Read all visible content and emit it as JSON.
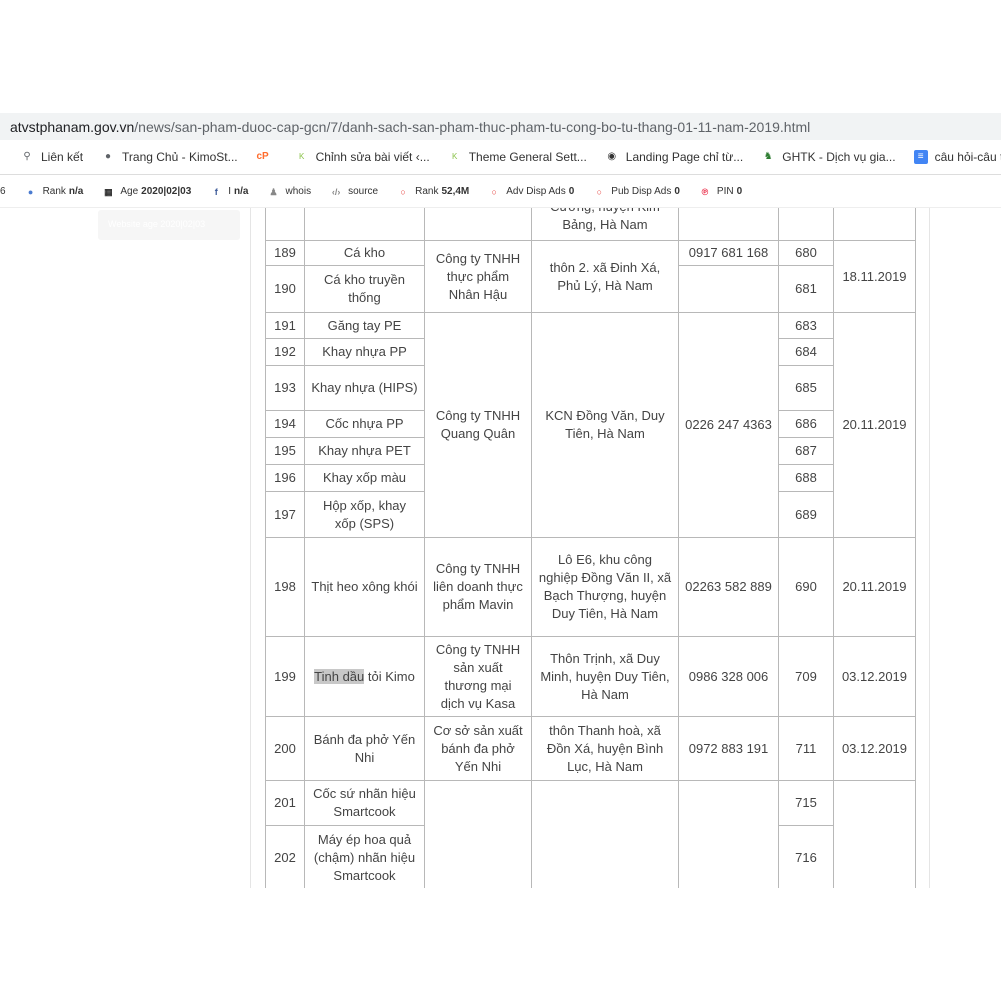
{
  "browser": {
    "url_domain": "atvstphanam.gov.vn",
    "url_path": "/news/san-pham-duoc-cap-gcn/7/danh-sach-san-pham-thuc-pham-tu-cong-bo-tu-thang-01-11-nam-2019.html"
  },
  "bookmarks": [
    {
      "label": "Liên kết",
      "icon": "link-icon",
      "color": "#5f6368"
    },
    {
      "label": "Trang Chủ - KimoSt...",
      "icon": "globe-icon",
      "color": "#5f6368"
    },
    {
      "label": "",
      "icon": "cpanel-icon",
      "color": "#ff6c2c"
    },
    {
      "label": "Chỉnh sửa bài viết ‹...",
      "icon": "kimo-shop-icon",
      "color": "#8bc34a"
    },
    {
      "label": "Theme General Sett...",
      "icon": "kimo-shop-icon",
      "color": "#8bc34a"
    },
    {
      "label": "Landing Page chỉ từ...",
      "icon": "landing-icon",
      "color": "#333333"
    },
    {
      "label": "GHTK - Dịch vụ gia...",
      "icon": "ghtk-icon",
      "color": "#2e7d32"
    },
    {
      "label": "câu hỏi-câu tra",
      "icon": "docs-icon",
      "color": "#4285f4"
    }
  ],
  "extension": [
    {
      "label": "6",
      "value": "",
      "icon": ""
    },
    {
      "label": "Rank",
      "value": "n/a",
      "icon": "alexa-icon"
    },
    {
      "label": "Age",
      "value": "2020|02|03",
      "icon": "calendar-icon"
    },
    {
      "label": "I",
      "value": "n/a",
      "icon": "facebook-icon"
    },
    {
      "label": "whois",
      "value": "",
      "icon": "user-icon"
    },
    {
      "label": "source",
      "value": "",
      "icon": "code-icon"
    },
    {
      "label": "Rank",
      "value": "52,4M",
      "icon": "opera-icon"
    },
    {
      "label": "Adv Disp Ads",
      "value": "0",
      "icon": "opera-icon"
    },
    {
      "label": "Pub Disp Ads",
      "value": "0",
      "icon": "opera-icon"
    },
    {
      "label": "PIN",
      "value": "0",
      "icon": "pinterest-icon"
    }
  ],
  "sidebox": "Website age 2020|02|03",
  "table": {
    "partial_address": "Cương, huyện Kim Bảng, Hà Nam",
    "g1": {
      "company": "Công ty TNHH thực phẩm Nhân Hậu",
      "address": "thôn 2. xã Đinh Xá, Phủ Lý, Hà Nam",
      "date": "18.11.2019",
      "rows": [
        {
          "stt": "189",
          "name": "Cá kho",
          "phone": "0917 681 168",
          "no": "680"
        },
        {
          "stt": "190",
          "name": "Cá kho truyền thống",
          "phone": "",
          "no": "681"
        }
      ]
    },
    "g2": {
      "company": "Công ty TNHH Quang Quân",
      "address": "KCN Đồng Văn, Duy Tiên, Hà Nam",
      "phone": "0226 247 4363",
      "date": "20.11.2019",
      "rows": [
        {
          "stt": "191",
          "name": "Găng tay PE",
          "no": "683"
        },
        {
          "stt": "192",
          "name": "Khay nhựa PP",
          "no": "684"
        },
        {
          "stt": "193",
          "name": "Khay nhựa (HIPS)",
          "no": "685"
        },
        {
          "stt": "194",
          "name": "Cốc nhựa PP",
          "no": "686"
        },
        {
          "stt": "195",
          "name": "Khay nhựa PET",
          "no": "687"
        },
        {
          "stt": "196",
          "name": "Khay xốp màu",
          "no": "688"
        },
        {
          "stt": "197",
          "name": "Hộp xốp, khay xốp (SPS)",
          "no": "689"
        }
      ]
    },
    "r198": {
      "stt": "198",
      "name": "Thịt heo xông khói",
      "company": "Công ty TNHH liên doanh thực phẩm Mavin",
      "address": "Lô E6, khu công nghiệp Đồng Văn II, xã Bạch Thượng, huyện Duy Tiên, Hà Nam",
      "phone": "02263 582 889",
      "no": "690",
      "date": "20.11.2019"
    },
    "r199": {
      "stt": "199",
      "name_hl": "Tinh dầu",
      "name_rest": " tỏi Kimo",
      "company": "Công ty TNHH sản xuất thương mại dịch vụ Kasa",
      "address": "Thôn Trịnh, xã Duy Minh, huyện Duy Tiên, Hà Nam",
      "phone": "0986 328 006",
      "no": "709",
      "date": "03.12.2019"
    },
    "r200": {
      "stt": "200",
      "name": "Bánh đa phở Yến Nhi",
      "company": "Cơ sở sản xuất bánh đa phở Yến Nhi",
      "address": "thôn Thanh hoà, xã Đồn Xá, huyện Bình Lục, Hà Nam",
      "phone": "0972 883 191",
      "no": "711",
      "date": "03.12.2019"
    },
    "g3": {
      "rows": [
        {
          "stt": "201",
          "name": "Cốc sứ nhãn hiệu Smartcook",
          "no": "715"
        },
        {
          "stt": "202",
          "name": "Máy ép hoa quả (chậm) nhãn hiệu Smartcook",
          "no": "716"
        }
      ]
    }
  }
}
